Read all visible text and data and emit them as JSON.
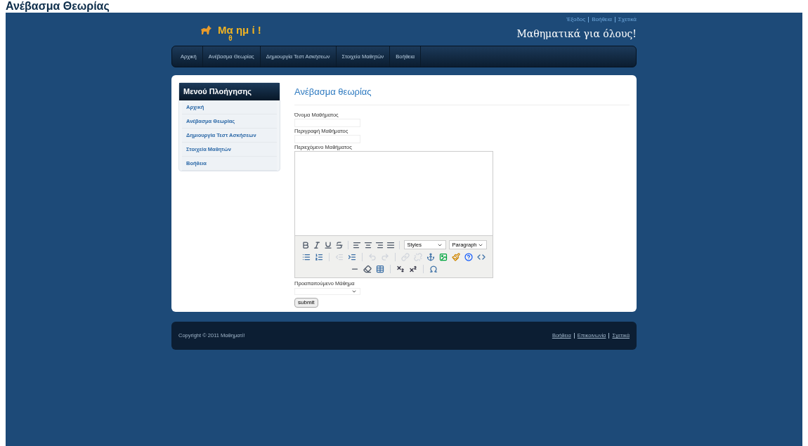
{
  "page_caption": "Ανέβασμα Θεωρίας",
  "header": {
    "logo_text": "Μα ημ ί !",
    "logo_fallen_letter": "θ",
    "top_links": [
      "Έξοδος",
      "Βοήθεια",
      "Σχετικά"
    ],
    "tagline": "Μαθηματικά για όλους!"
  },
  "nav": [
    "Αρχική",
    "Ανέβασμα Θεωρίας",
    "Δημιουργία Τεστ Ασκήσεων",
    "Στοιχεία Μαθητών",
    "Βοήθεια"
  ],
  "sidebar": {
    "title": "Μενού Πλοήγησης",
    "items": [
      "Αρχική",
      "Ανέβασμα Θεωρίας",
      "Δημιουργία Τεστ Ασκήσεων",
      "Στοιχεία Μαθητών",
      "Βοήθεια"
    ]
  },
  "form": {
    "title": "Ανέβασμα θεωρίας",
    "name_label": "Όνομα Μαθήματος",
    "description_label": "Περιγραφή Μαθήματος",
    "content_label": "Περιεχόμενο Μαθήματος",
    "styles_select": "Styles",
    "format_select": "Paragraph",
    "prerequisite_label": "Προαπαιτούμενο Μάθημα",
    "submit": "submit"
  },
  "footer": {
    "copyright": "Copyright © 2011 Μαθηματί!",
    "links": [
      "Βοήθεια",
      "Επικοινωνία",
      "Σχετικά"
    ]
  }
}
